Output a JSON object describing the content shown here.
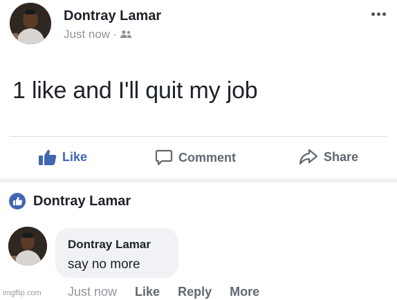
{
  "post": {
    "author": "Dontray Lamar",
    "timestamp": "Just now",
    "meta_separator": "·",
    "audience_icon": "friends-icon",
    "text": "1 like and I'll quit my job"
  },
  "actions": {
    "like": "Like",
    "comment": "Comment",
    "share": "Share"
  },
  "commenting_as": {
    "name": "Dontray Lamar"
  },
  "comment": {
    "author": "Dontray Lamar",
    "text": "say no more",
    "timestamp": "Just now",
    "like": "Like",
    "reply": "Reply",
    "more": "More"
  },
  "watermark": "imgflip.com",
  "colors": {
    "like_blue": "#4267b2",
    "text_dark": "#1d2129",
    "text_gray": "#90949c"
  }
}
